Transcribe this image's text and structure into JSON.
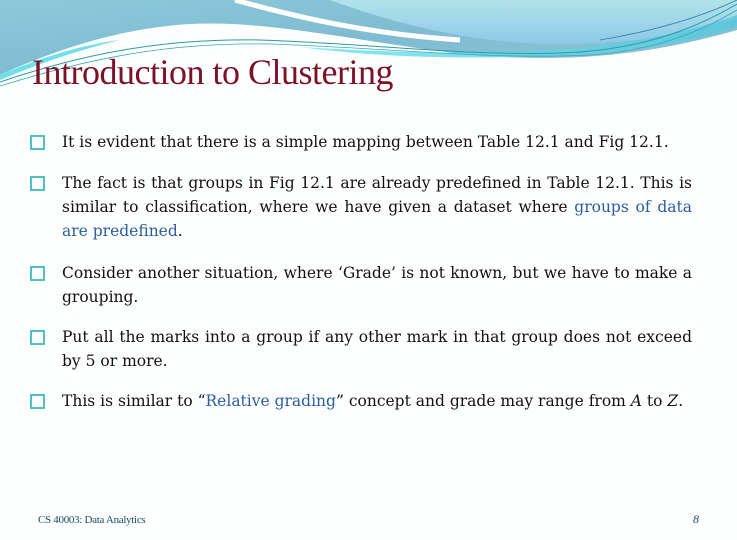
{
  "slide": {
    "title": "Introduction to Clustering",
    "bullets": [
      {
        "segments": [
          {
            "text": "It is evident that there is a simple mapping between Table 12.1 and Fig 12.1.",
            "style": "normal"
          }
        ]
      },
      {
        "segments": [
          {
            "text": "The fact is that groups in Fig 12.1 are already predefined in Table 12.1. This is similar to classification, where we have given a dataset where ",
            "style": "normal"
          },
          {
            "text": "groups of data are predefined",
            "style": "highlight"
          },
          {
            "text": ".",
            "style": "normal"
          }
        ]
      },
      {
        "segments": [
          {
            "text": "Consider another situation, where ‘Grade’ is not known, but we have to make a grouping.",
            "style": "normal"
          }
        ]
      },
      {
        "segments": [
          {
            "text": "Put all the marks into a group if any other mark in that group does not exceed by 5 or more.",
            "style": "normal"
          }
        ]
      },
      {
        "segments": [
          {
            "text": "This is similar to “",
            "style": "normal"
          },
          {
            "text": "Relative grading",
            "style": "highlight"
          },
          {
            "text": "” concept and grade may range from ",
            "style": "normal"
          },
          {
            "text": "A",
            "style": "italic"
          },
          {
            "text": " to ",
            "style": "normal"
          },
          {
            "text": "Z",
            "style": "italic"
          },
          {
            "text": ".",
            "style": "normal"
          }
        ]
      }
    ],
    "bullet_icon": "hollow-square-bullet-icon"
  },
  "footer": {
    "course": "CS 40003: Data Analytics",
    "page_number": "8"
  },
  "colors": {
    "title": "#7d1128",
    "highlight": "#2a5e9b",
    "bullet_box": "#4fc0c4",
    "footer": "#1a5064",
    "header_wave_dark": "#7fbcd2",
    "header_wave_light": "#a8dde6",
    "header_wave_cyan": "#6ee0ea"
  }
}
